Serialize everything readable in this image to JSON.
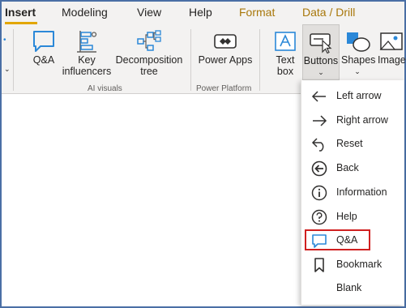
{
  "tabs": [
    {
      "label": "Insert",
      "active": true
    },
    {
      "label": "Modeling"
    },
    {
      "label": "View"
    },
    {
      "label": "Help"
    },
    {
      "label": "Format",
      "accent": true
    },
    {
      "label": "Data / Drill",
      "accent": true
    }
  ],
  "ribbon": {
    "qa": {
      "label": "Q&A",
      "icon": "qa-icon"
    },
    "key_influencers": {
      "line1": "Key",
      "line2": "influencers",
      "icon": "key-influencers-icon"
    },
    "decomposition_tree": {
      "line1": "Decomposition",
      "line2": "tree",
      "icon": "decomposition-tree-icon"
    },
    "power_apps": {
      "label": "Power Apps",
      "icon": "power-apps-icon"
    },
    "text_box": {
      "line1": "Text",
      "line2": "box",
      "icon": "text-box-icon"
    },
    "buttons": {
      "label": "Buttons",
      "chevron": "⌄",
      "icon": "buttons-icon"
    },
    "shapes": {
      "label": "Shapes",
      "chevron": "⌄",
      "icon": "shapes-icon"
    },
    "image": {
      "label": "Image",
      "icon": "image-icon"
    },
    "groups": {
      "ai_visuals": "AI visuals",
      "power_platform": "Power Platform"
    },
    "left_chevron": "⌄"
  },
  "menu": {
    "items": [
      {
        "label": "Left arrow",
        "icon": "left-arrow-icon"
      },
      {
        "label": "Right arrow",
        "icon": "right-arrow-icon"
      },
      {
        "label": "Reset",
        "icon": "reset-icon"
      },
      {
        "label": "Back",
        "icon": "back-icon"
      },
      {
        "label": "Information",
        "icon": "information-icon"
      },
      {
        "label": "Help",
        "icon": "help-icon"
      },
      {
        "label": "Q&A",
        "icon": "qa-icon",
        "highlighted": true
      },
      {
        "label": "Bookmark",
        "icon": "bookmark-icon"
      },
      {
        "label": "Blank",
        "icon": ""
      }
    ]
  },
  "colors": {
    "frame": "#4a6fa5",
    "ribbon_bg": "#f3f2f1",
    "tab_accent": "#a8770a",
    "active_underline": "#e2a600",
    "icon_blue": "#2b88d8",
    "highlight_border": "#d02020"
  }
}
